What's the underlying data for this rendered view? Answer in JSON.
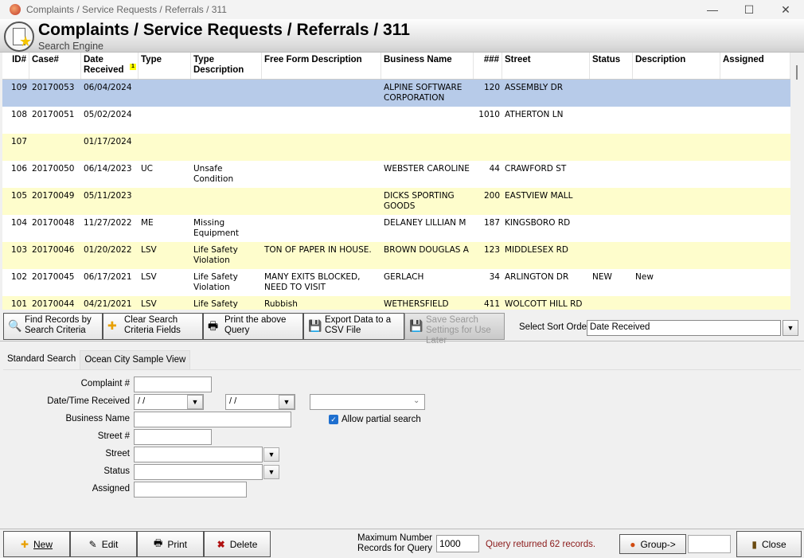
{
  "window": {
    "title": "Complaints / Service Requests / Referrals / 311",
    "min": "—",
    "max": "☐",
    "close": "✕"
  },
  "header": {
    "title": "Complaints / Service Requests / Referrals / 311",
    "subtitle": "Search Engine"
  },
  "grid": {
    "columns": [
      "ID#",
      "Case#",
      "Date Received",
      "Type",
      "Type Description",
      "Free Form Description",
      "Business Name",
      "###",
      "Street",
      "Status",
      "Description",
      "Assigned"
    ],
    "sort_indicator": "1",
    "rows": [
      {
        "id": "109",
        "case": "20170053",
        "date": "06/04/2024",
        "type": "",
        "type_desc": "",
        "free_desc": "",
        "business": "ALPINE SOFTWARE CORPORATION",
        "num": "120",
        "street": "ASSEMBLY DR",
        "status": "",
        "desc": "",
        "assigned": "",
        "selected": true
      },
      {
        "id": "108",
        "case": "20170051",
        "date": "05/02/2024",
        "type": "",
        "type_desc": "",
        "free_desc": "",
        "business": "",
        "num": "1010",
        "street": "ATHERTON LN",
        "status": "",
        "desc": "",
        "assigned": ""
      },
      {
        "id": "107",
        "case": "",
        "date": "01/17/2024",
        "type": "",
        "type_desc": "",
        "free_desc": "",
        "business": "",
        "num": "",
        "street": "",
        "status": "",
        "desc": "",
        "assigned": ""
      },
      {
        "id": "106",
        "case": "20170050",
        "date": "06/14/2023",
        "type": "UC",
        "type_desc": "Unsafe Condition",
        "free_desc": "",
        "business": "WEBSTER CAROLINE",
        "num": "44",
        "street": "CRAWFORD ST",
        "status": "",
        "desc": "",
        "assigned": ""
      },
      {
        "id": "105",
        "case": "20170049",
        "date": "05/11/2023",
        "type": "",
        "type_desc": "",
        "free_desc": "",
        "business": "DICKS SPORTING GOODS",
        "num": "200",
        "street": "EASTVIEW MALL",
        "status": "",
        "desc": "",
        "assigned": ""
      },
      {
        "id": "104",
        "case": "20170048",
        "date": "11/27/2022",
        "type": "ME",
        "type_desc": "Missing Equipment",
        "free_desc": "",
        "business": "DELANEY LILLIAN M",
        "num": "187",
        "street": "KINGSBORO RD",
        "status": "",
        "desc": "",
        "assigned": ""
      },
      {
        "id": "103",
        "case": "20170046",
        "date": "01/20/2022",
        "type": "LSV",
        "type_desc": "Life Safety Violation",
        "free_desc": "TON OF PAPER IN HOUSE.",
        "business": "BROWN DOUGLAS A",
        "num": "123",
        "street": "MIDDLESEX RD",
        "status": "",
        "desc": "",
        "assigned": ""
      },
      {
        "id": "102",
        "case": "20170045",
        "date": "06/17/2021",
        "type": "LSV",
        "type_desc": "Life Safety Violation",
        "free_desc": "MANY EXITS BLOCKED, NEED TO VISIT",
        "business": "GERLACH",
        "num": "34",
        "street": "ARLINGTON DR",
        "status": "NEW",
        "desc": "New",
        "assigned": ""
      },
      {
        "id": "101",
        "case": "20170044",
        "date": "04/21/2021",
        "type": "LSV",
        "type_desc": "Life Safety",
        "free_desc": "Rubbish",
        "business": "WETHERSFIELD",
        "num": "411",
        "street": "WOLCOTT HILL RD",
        "status": "",
        "desc": "",
        "assigned": ""
      }
    ]
  },
  "toolbar": {
    "find": "Find Records by Search Criteria",
    "clear": "Clear Search Criteria Fields",
    "print_query": "Print the above Query",
    "export": "Export Data to a CSV File",
    "save_settings": "Save Search Settings for Use Later",
    "sort_label": "Select Sort Order",
    "sort_value": "Date Received"
  },
  "tabs": [
    {
      "label": "Standard Search"
    },
    {
      "label": "Ocean City Sample View"
    }
  ],
  "form": {
    "complaint_label": "Complaint #",
    "complaint_value": "",
    "date_label": "Date/Time Received",
    "date_from": " /  /",
    "date_to": " /  /",
    "date_range": "",
    "business_label": "Business Name",
    "business_value": "",
    "partial_label": "Allow partial search",
    "partial_checked": true,
    "streetnum_label": "Street #",
    "streetnum_value": "",
    "street_label": "Street",
    "street_value": "",
    "status_label": "Status",
    "status_value": "",
    "assigned_label": "Assigned",
    "assigned_value": ""
  },
  "bottom": {
    "new": "New",
    "edit": "Edit",
    "print": "Print",
    "delete": "Delete",
    "max_label": "Maximum Number Records for Query",
    "max_value": "1000",
    "query_status": "Query returned 62 records.",
    "group": "Group->",
    "group_value": "",
    "close": "Close"
  }
}
